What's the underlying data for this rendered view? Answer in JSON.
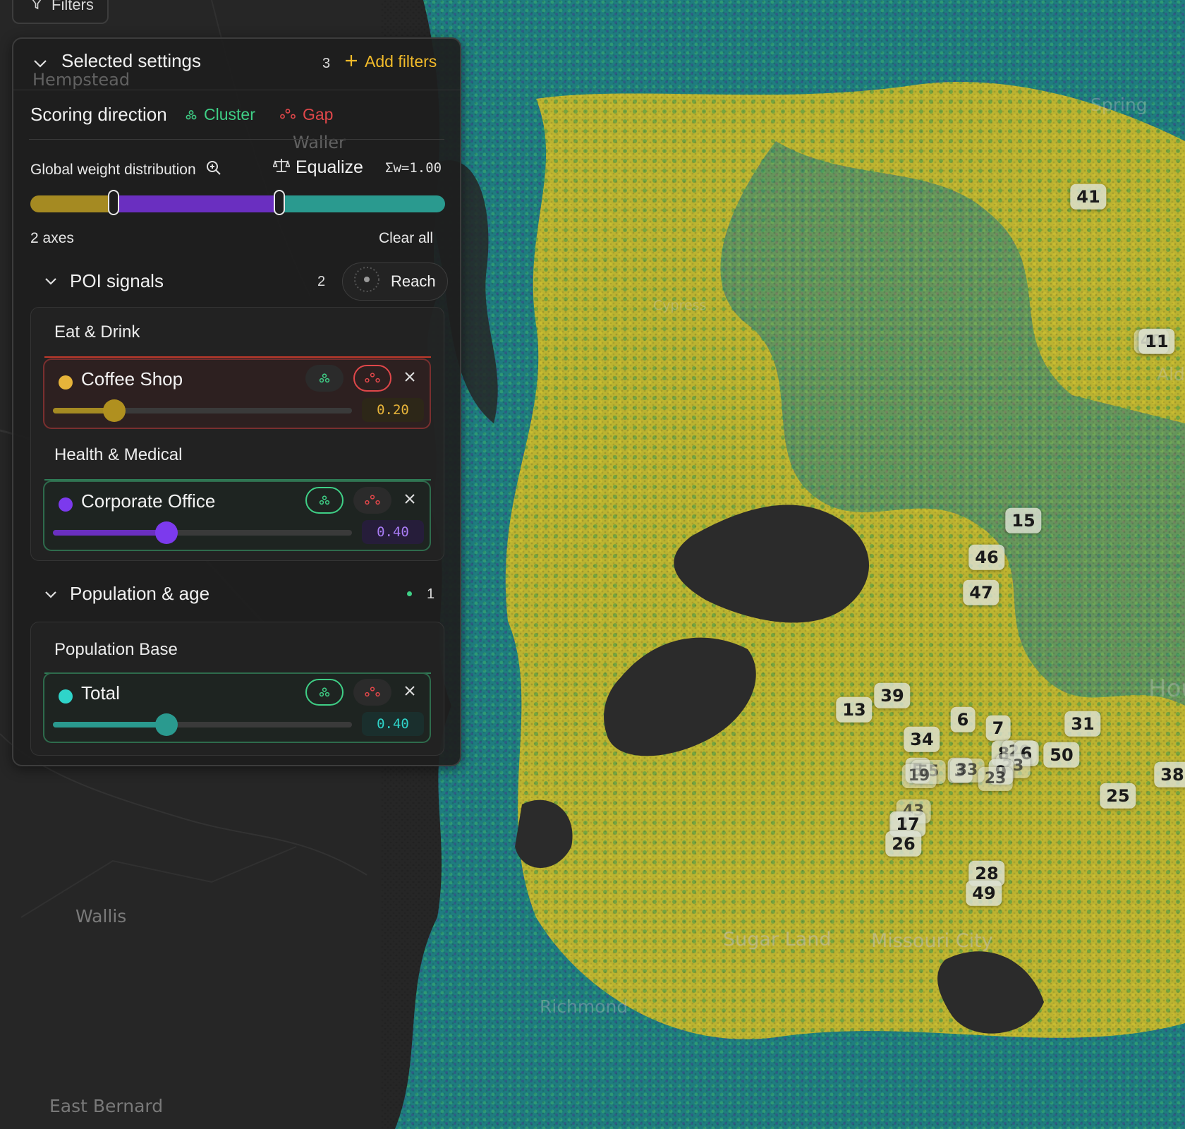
{
  "filters_tab": {
    "label": "Filters"
  },
  "panel": {
    "title": "Selected settings",
    "count": "3",
    "add_filters": "Add filters",
    "scoring": {
      "label": "Scoring direction",
      "cluster": "Cluster",
      "gap": "Gap"
    },
    "weights": {
      "label": "Global weight distribution",
      "equalize": "Equalize",
      "sum": "Σw=1.00",
      "segments": [
        {
          "value": 0.2,
          "color": "#a58a22"
        },
        {
          "value": 0.4,
          "color": "#6a2fc0"
        },
        {
          "value": 0.4,
          "color": "#2a9a8f"
        }
      ]
    },
    "axes_label": "2 axes",
    "clear_all": "Clear all",
    "sections": [
      {
        "title": "POI signals",
        "count": "2",
        "reach": "Reach",
        "groups": [
          {
            "category": "Eat & Drink",
            "signal": {
              "name": "Coffee Shop",
              "color": "#e7b43a",
              "weight": "0.20",
              "level": 0.2,
              "mode": "gap"
            }
          },
          {
            "category": "Health & Medical",
            "signal": {
              "name": "Corporate Office",
              "color": "#7c3aed",
              "weight": "0.40",
              "level": 0.4,
              "mode": "cluster"
            }
          }
        ]
      },
      {
        "title": "Population & age",
        "count": "1",
        "groups": [
          {
            "category": "Population Base",
            "signal": {
              "name": "Total",
              "color": "#2fd4c9",
              "weight": "0.40",
              "level": 0.4,
              "mode": "cluster"
            }
          }
        ]
      }
    ]
  },
  "map": {
    "places": [
      "Hempstead",
      "Waller",
      "Spring",
      "Cypress",
      "Aldi",
      "Hou",
      "Wallis",
      "Sugar Land",
      "Missouri City",
      "Richmond",
      "East Bernard"
    ],
    "clusters": [
      "41",
      "40",
      "11",
      "15",
      "46",
      "47",
      "39",
      "13",
      "6",
      "7",
      "31",
      "34",
      "8",
      "20",
      "6",
      "50",
      "23",
      "38",
      "5",
      "55",
      "19",
      "3",
      "33",
      "9",
      "23",
      "25",
      "43",
      "2",
      "17",
      "26",
      "28",
      "49"
    ]
  }
}
